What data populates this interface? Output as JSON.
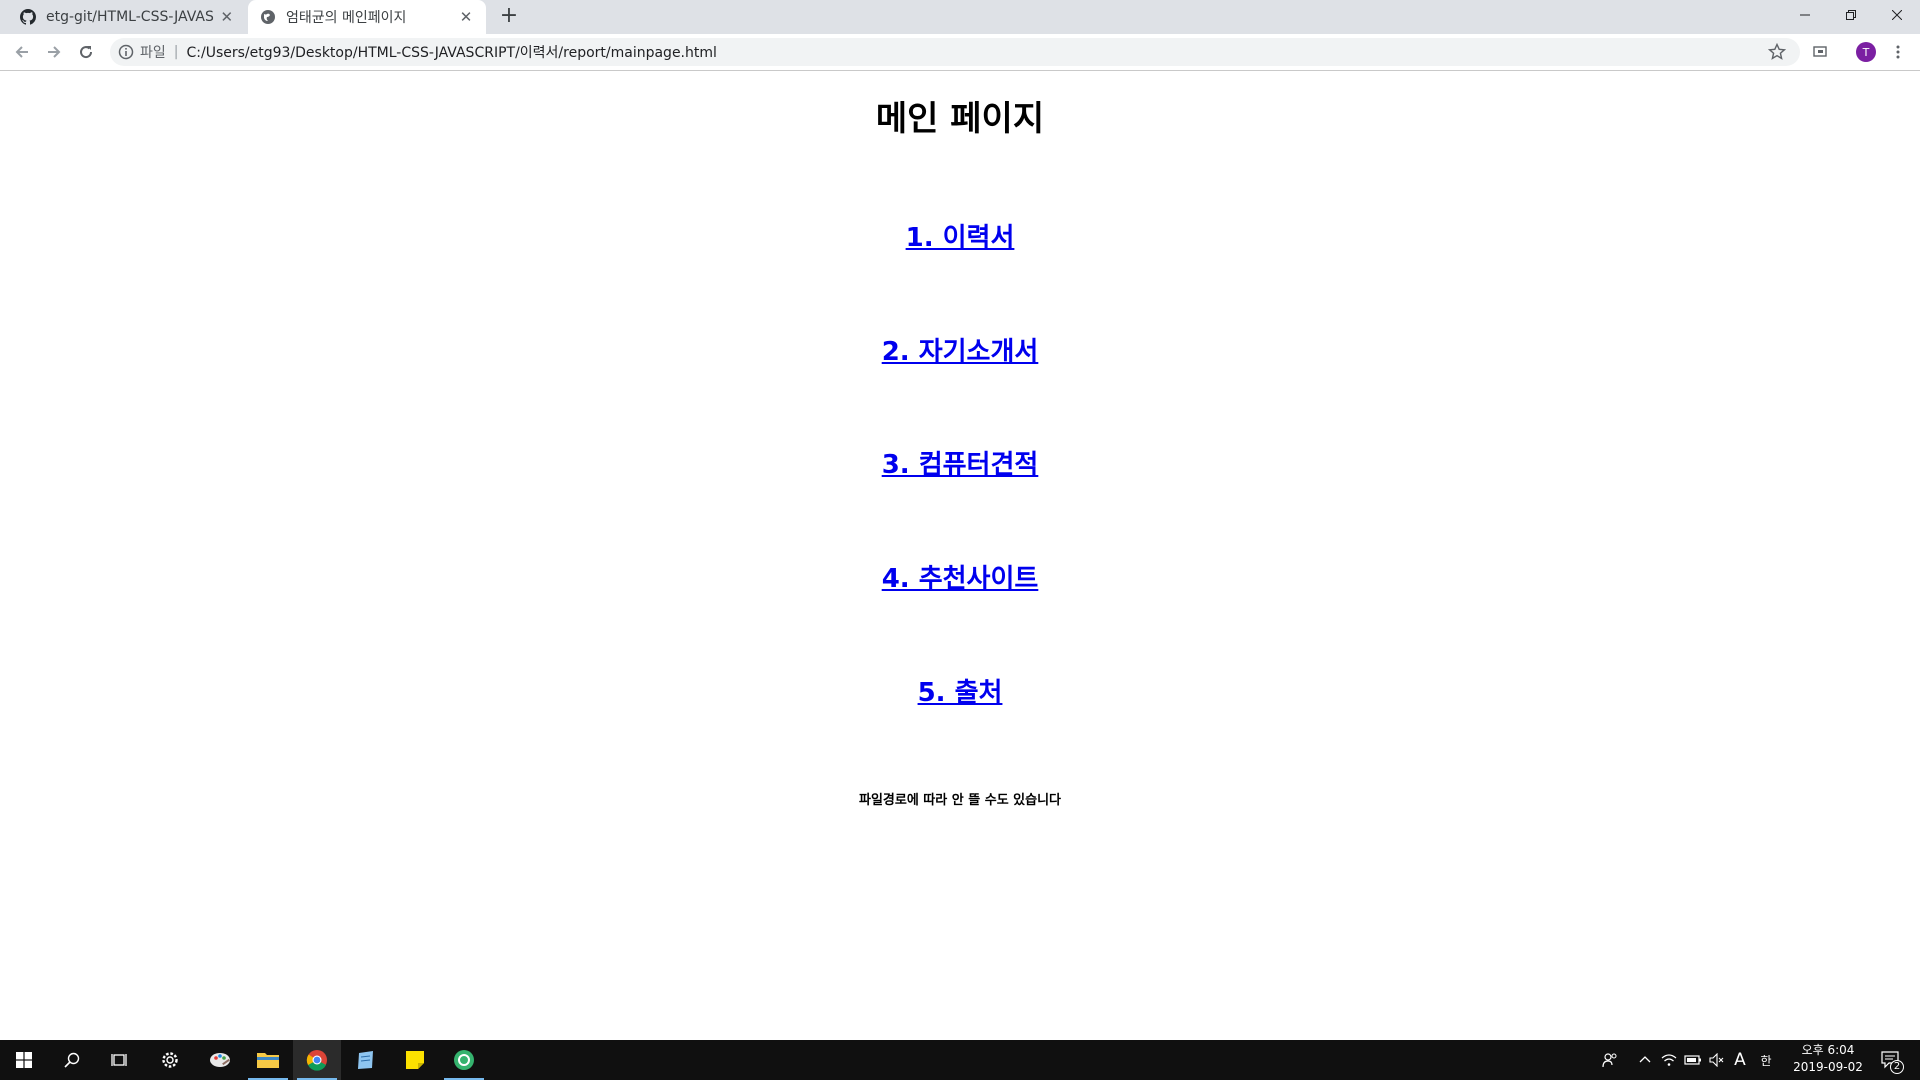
{
  "browser": {
    "tabs": [
      {
        "title": "etg-git/HTML-CSS-JAVASCR",
        "icon": "github-icon",
        "active": false
      },
      {
        "title": "엄태균의 메인페이지",
        "icon": "globe-icon",
        "active": true
      }
    ],
    "address_bar": {
      "scheme_label": "파일",
      "url": "C:/Users/etg93/Desktop/HTML-CSS-JAVASCRIPT/이력서/report/mainpage.html"
    },
    "profile_initial": "T"
  },
  "page": {
    "heading": "메인 페이지",
    "links": [
      {
        "label": "1. 이력서"
      },
      {
        "label": "2. 자기소개서"
      },
      {
        "label": "3. 컴퓨터견적"
      },
      {
        "label": "4. 추천사이트"
      },
      {
        "label": "5. 출처"
      }
    ],
    "note": "파일경로에 따라 안 뜰 수도 있습니다"
  },
  "taskbar": {
    "clock_time": "오후 6:04",
    "clock_date": "2019-09-02",
    "ime_label": "A",
    "ime_mode": "한",
    "notification_count": "2"
  },
  "colors": {
    "link": "#0000ee",
    "tabstrip": "#dee1e6",
    "taskbar": "#101010",
    "profile_avatar": "#7b1fa2"
  }
}
